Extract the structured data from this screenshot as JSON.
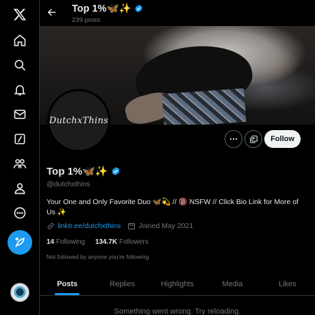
{
  "nav": {
    "items": [
      {
        "icon": "x-logo-icon"
      },
      {
        "icon": "home-icon"
      },
      {
        "icon": "explore-icon"
      },
      {
        "icon": "notifications-icon"
      },
      {
        "icon": "messages-icon"
      },
      {
        "icon": "grok-icon"
      },
      {
        "icon": "communities-icon"
      },
      {
        "icon": "profile-icon"
      },
      {
        "icon": "more-icon"
      }
    ],
    "post_icon": "compose-post-icon"
  },
  "header": {
    "title": "Top 1%🦋✨",
    "post_count": "239 posts"
  },
  "profile": {
    "avatar_text": "DutchxThins",
    "display_name": "Top 1%🦋✨",
    "handle": "@dutchxthins",
    "bio": "Your One and Only Favorite Duo 🦋💫 // 🔞 NSFW // Click Bio Link for More of Us ✨",
    "link": "linktr.ee/dutchxthins",
    "joined": "Joined May 2021",
    "following_count": "14",
    "following_label": "Following",
    "followers_count": "134.7K",
    "followers_label": "Followers",
    "followed_by": "Not followed by anyone you’re following",
    "follow_label": "Follow"
  },
  "tabs": [
    "Posts",
    "Replies",
    "Highlights",
    "Media",
    "Likes"
  ],
  "active_tab": "Posts",
  "error_message": "Something went wrong. Try reloading.",
  "colors": {
    "accent": "#1d9bf0",
    "background": "#000000",
    "muted_text": "#71767b",
    "primary_text": "#e7e9ea"
  }
}
